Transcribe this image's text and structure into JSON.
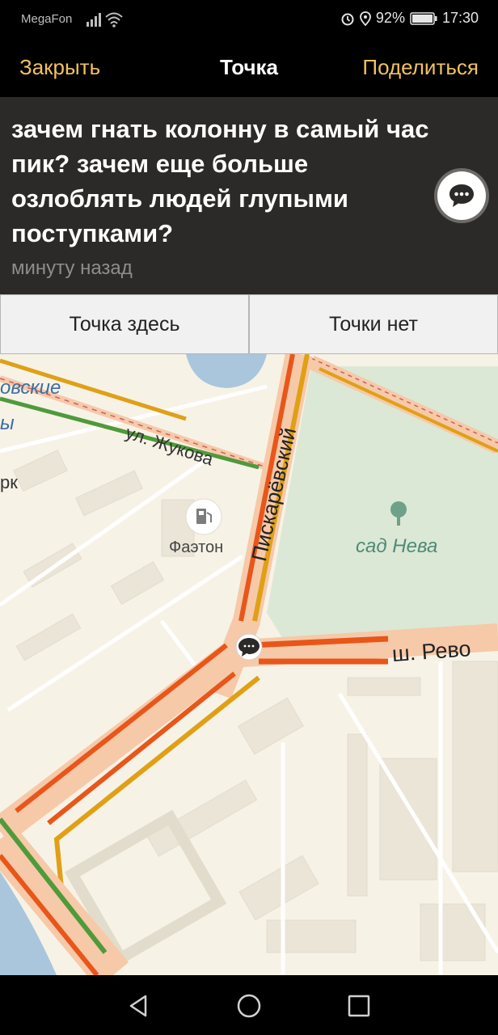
{
  "status_bar": {
    "carrier": "MegaFon",
    "battery": "92%",
    "time": "17:30"
  },
  "header": {
    "close_label": "Закрыть",
    "title": "Точка",
    "share_label": "Поделиться"
  },
  "message": {
    "text": "зачем гнать колонну в самый час пик? зачем еще больше озлоблять людей глупыми поступками?",
    "time": "минуту назад"
  },
  "actions": {
    "here_label": "Точка здесь",
    "gone_label": "Точки нет"
  },
  "map": {
    "labels": {
      "street_zhukova": "ул. Жукова",
      "street_piskarevsky": "Пискарёвский",
      "park": "сад Нева",
      "fuel_station": "Фаэтон",
      "street_revo": "ш. Рево",
      "partial_blue_1": "овские",
      "partial_blue_2": "ы",
      "partial_rk": "рк"
    }
  },
  "icons": {
    "signal": "signal-icon",
    "wifi": "wifi-icon",
    "alarm": "alarm-icon",
    "location": "location-icon",
    "battery": "battery-icon",
    "chat": "chat-icon",
    "fuel": "fuel-icon",
    "back": "back-icon",
    "home": "home-icon",
    "recents": "recents-icon"
  },
  "colors": {
    "accent": "#f2c25c",
    "traffic_red": "#e8561a",
    "traffic_yellow": "#e0a016",
    "traffic_green": "#4f9a3a",
    "park_green": "#dbe8d5"
  }
}
